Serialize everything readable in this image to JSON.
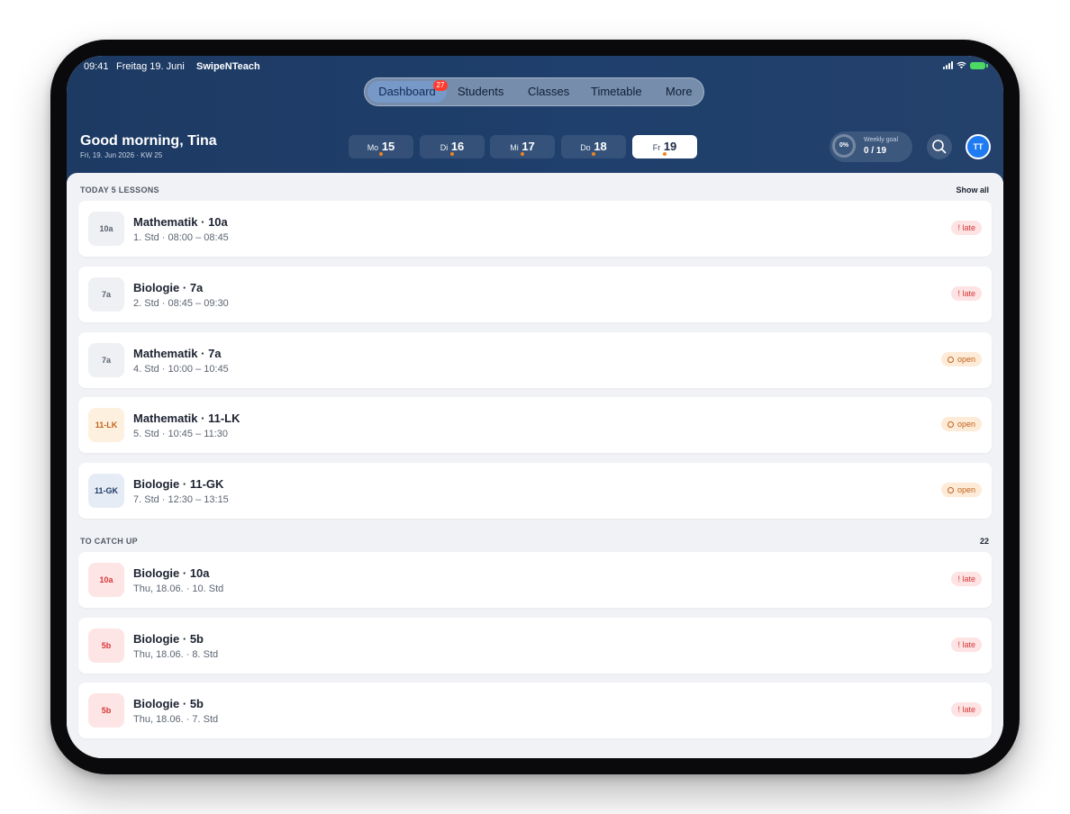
{
  "status_bar": {
    "time": "09:41",
    "date": "Freitag 19. Juni",
    "app": "SwipeNTeach"
  },
  "nav": {
    "items": [
      {
        "label": "Dashboard",
        "active": true
      },
      {
        "label": "Students"
      },
      {
        "label": "Classes"
      },
      {
        "label": "Timetable"
      },
      {
        "label": "More"
      }
    ],
    "badge": "27"
  },
  "header": {
    "greeting": "Good morning, Tina",
    "subline": "Fri, 19. Jun 2026 · KW 25"
  },
  "days": [
    {
      "weekday": "Mo",
      "num": "15"
    },
    {
      "weekday": "Di",
      "num": "16"
    },
    {
      "weekday": "Mi",
      "num": "17"
    },
    {
      "weekday": "Do",
      "num": "18"
    },
    {
      "weekday": "Fr",
      "num": "19",
      "active": true
    }
  ],
  "goal": {
    "percent": "0%",
    "label": "Weekly goal",
    "value": "0 / 19"
  },
  "avatar": "TT",
  "today": {
    "title": "TODAY 5 LESSONS",
    "action": "Show all",
    "lessons": [
      {
        "chip": "10a",
        "title": "Mathematik · 10a",
        "subtitle": "1. Std · 08:00 – 08:45",
        "status": "! late"
      },
      {
        "chip": "7a",
        "title": "Biologie · 7a",
        "subtitle": "2. Std · 08:45 – 09:30",
        "status": "! late"
      },
      {
        "chip": "7a",
        "title": "Mathematik · 7a",
        "subtitle": "4. Std · 10:00 – 10:45",
        "status": "open"
      },
      {
        "chip": "11-LK",
        "title": "Mathematik · 11-LK",
        "subtitle": "5. Std · 10:45 – 11:30",
        "status": "open"
      },
      {
        "chip": "11-GK",
        "title": "Biologie · 11-GK",
        "subtitle": "7. Std · 12:30 – 13:15",
        "status": "open"
      }
    ]
  },
  "catchup": {
    "title": "TO CATCH UP",
    "count": "22",
    "items": [
      {
        "chip": "10a",
        "title": "Biologie · 10a",
        "subtitle": "Thu, 18.06. · 10. Std",
        "status": "! late"
      },
      {
        "chip": "5b",
        "title": "Biologie · 5b",
        "subtitle": "Thu, 18.06. · 8. Std",
        "status": "! late"
      },
      {
        "chip": "5b",
        "title": "Biologie · 5b",
        "subtitle": "Thu, 18.06. · 7. Std",
        "status": "! late"
      }
    ]
  },
  "colors": {
    "header": "#1f3f6c",
    "accent": "#1f7bf2",
    "late_bg": "#fde3e3",
    "late_text": "#d6383a",
    "open_bg": "#fdebd8",
    "open_text": "#c2621b",
    "dot": "#f0851f"
  }
}
